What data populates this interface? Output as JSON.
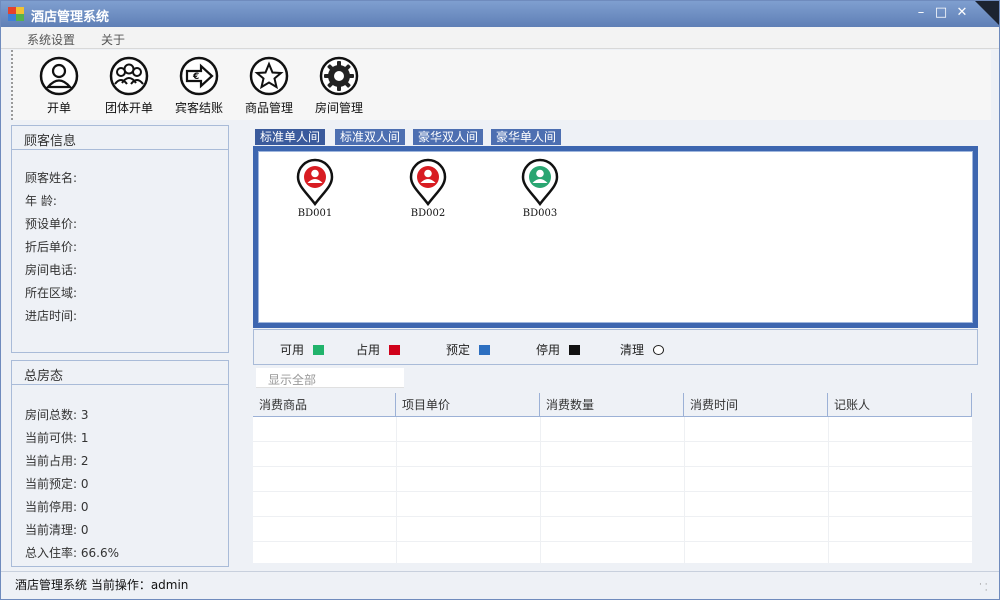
{
  "window": {
    "title": "酒店管理系统"
  },
  "menu": {
    "items": [
      "系统设置",
      "关于"
    ]
  },
  "toolbar": {
    "buttons": [
      {
        "label": "开单",
        "icon": "person-icon"
      },
      {
        "label": "团体开单",
        "icon": "group-icon"
      },
      {
        "label": "宾客结账",
        "icon": "checkout-icon"
      },
      {
        "label": "商品管理",
        "icon": "star-icon"
      },
      {
        "label": "房间管理",
        "icon": "gear-icon"
      }
    ]
  },
  "guest_info": {
    "title": "顾客信息",
    "fields": [
      "顾客姓名:",
      "年 龄:",
      "预设单价:",
      "折后单价:",
      "房间电话:",
      "所在区域:",
      "进店时间:"
    ]
  },
  "room_status": {
    "title": "总房态",
    "items": [
      "房间总数: 3",
      "当前可供: 1",
      "当前占用: 2",
      "当前预定: 0",
      "当前停用: 0",
      "当前清理: 0",
      "总入住率: 66.6%"
    ]
  },
  "tabs": [
    "标准单人间",
    "标准双人间",
    "豪华双人间",
    "豪华单人间"
  ],
  "rooms": [
    {
      "id": "BD001",
      "status": "occupied",
      "color": "#d81c22"
    },
    {
      "id": "BD002",
      "status": "occupied",
      "color": "#d81c22"
    },
    {
      "id": "BD003",
      "status": "available",
      "color": "#2aa672"
    }
  ],
  "legend": [
    {
      "label": "可用",
      "color": "#21b36b"
    },
    {
      "label": "占用",
      "color": "#d0021b"
    },
    {
      "label": "预定",
      "color": "#2d6fc0"
    },
    {
      "label": "停用",
      "color": "#111111"
    },
    {
      "label": "清理",
      "color": "#ffffff"
    }
  ],
  "filter": {
    "label": "显示全部"
  },
  "table": {
    "columns": [
      "消费商品",
      "项目单价",
      "消费数量",
      "消费时间",
      "记账人"
    ]
  },
  "status_bar": {
    "text": "酒店管理系统 当前操作：admin"
  }
}
